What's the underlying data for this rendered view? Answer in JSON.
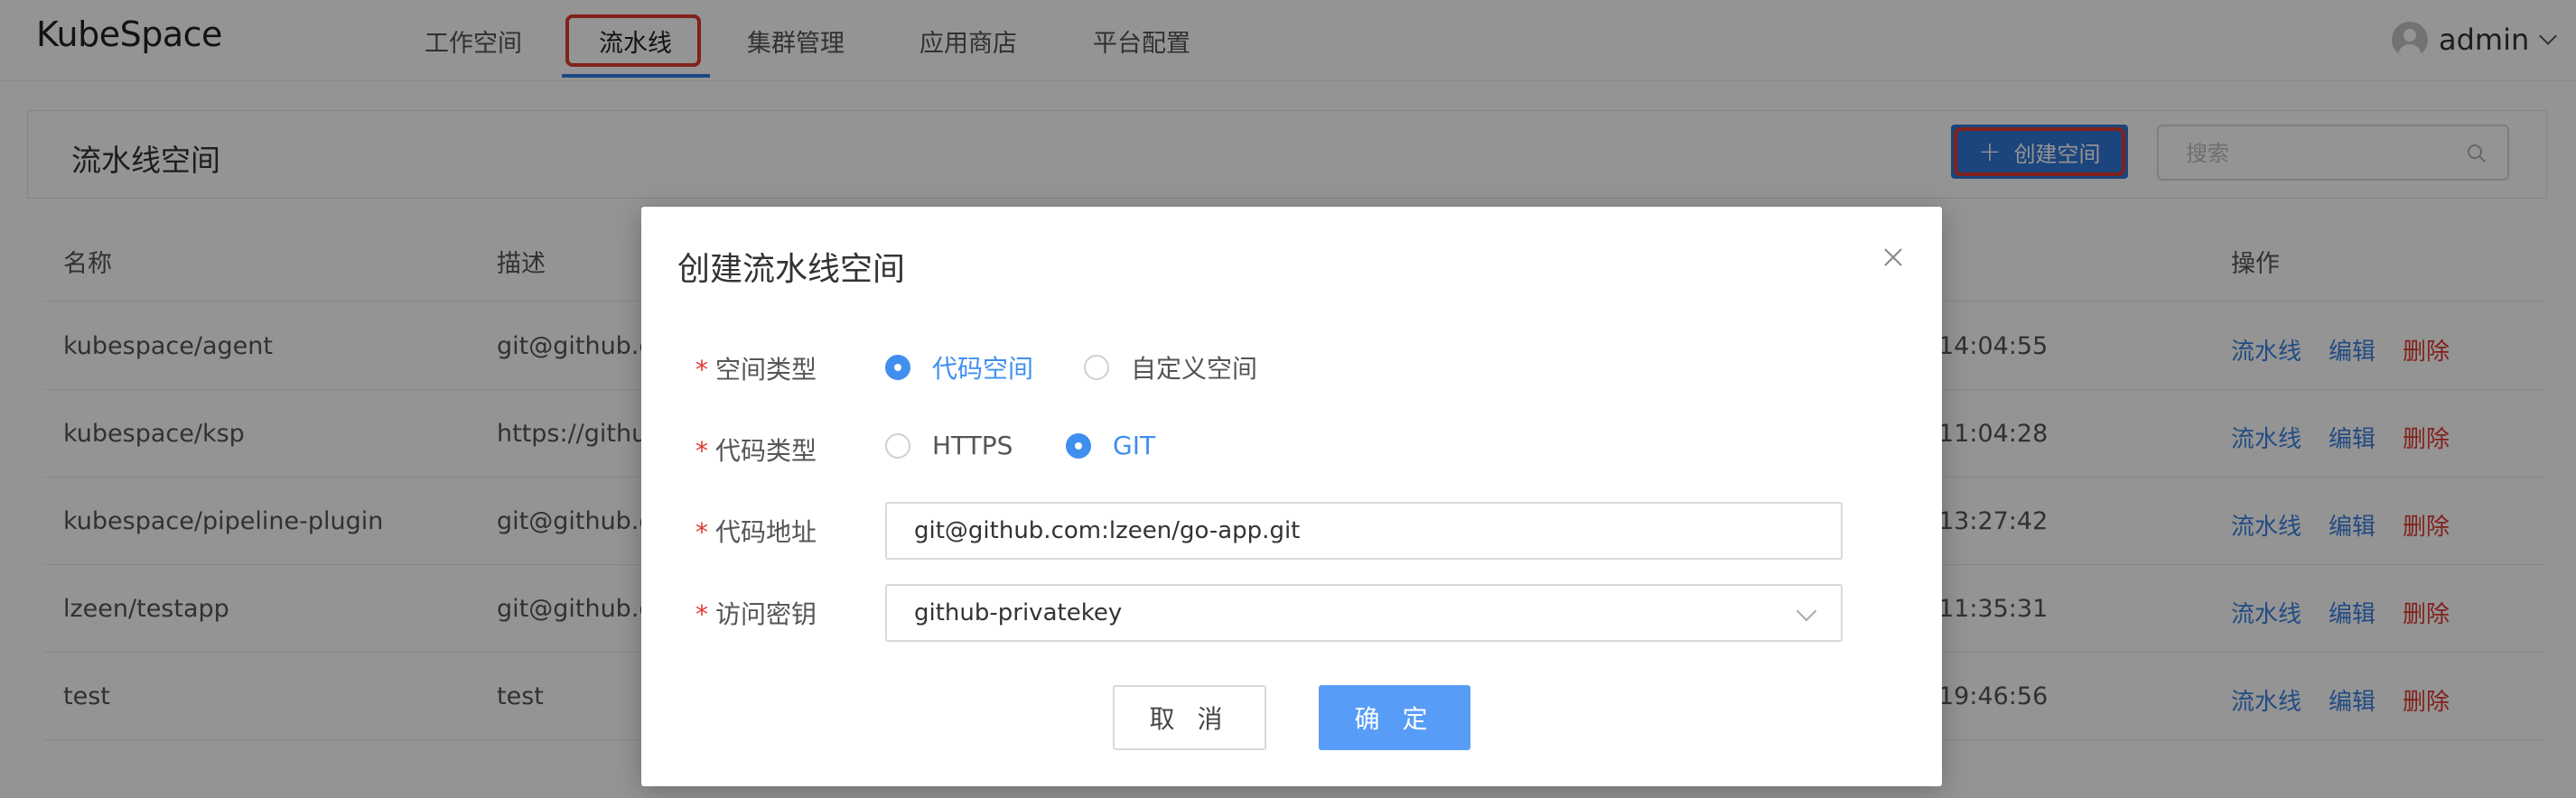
{
  "header": {
    "logo": "KubeSpace",
    "nav": [
      {
        "label": "工作空间"
      },
      {
        "label": "流水线"
      },
      {
        "label": "集群管理"
      },
      {
        "label": "应用商店"
      },
      {
        "label": "平台配置"
      }
    ],
    "active_nav": "流水线",
    "user": {
      "name": "admin"
    }
  },
  "page": {
    "title": "流水线空间",
    "create_button": "创建空间",
    "search_placeholder": "搜索"
  },
  "table": {
    "columns": [
      "名称",
      "描述",
      "操作"
    ],
    "rows": [
      {
        "name": "kubespace/agent",
        "desc": "git@github.co",
        "time": "14:04:55"
      },
      {
        "name": "kubespace/ksp",
        "desc": "https://githul",
        "time": "11:04:28"
      },
      {
        "name": "kubespace/pipeline-plugin",
        "desc": "git@github.co",
        "time": "13:27:42"
      },
      {
        "name": "lzeen/testapp",
        "desc": "git@github.co",
        "time": "11:35:31"
      },
      {
        "name": "test",
        "desc": "test",
        "time": "19:46:56"
      }
    ],
    "actions": {
      "pipeline": "流水线",
      "edit": "编辑",
      "delete": "删除"
    }
  },
  "modal": {
    "title": "创建流水线空间",
    "fields": {
      "space_type": {
        "label": "空间类型",
        "options": [
          "代码空间",
          "自定义空间"
        ],
        "selected": "代码空间"
      },
      "code_type": {
        "label": "代码类型",
        "options": [
          "HTTPS",
          "GIT"
        ],
        "selected": "GIT"
      },
      "code_url": {
        "label": "代码地址",
        "value": "git@github.com:lzeen/go-app.git"
      },
      "access_key": {
        "label": "访问密钥",
        "value": "github-privatekey"
      }
    },
    "cancel": "取 消",
    "confirm": "确 定"
  },
  "colors": {
    "primary": "#2f78d6",
    "highlight": "#e0392f",
    "link": "#3b82e0",
    "danger": "#e0392f"
  }
}
